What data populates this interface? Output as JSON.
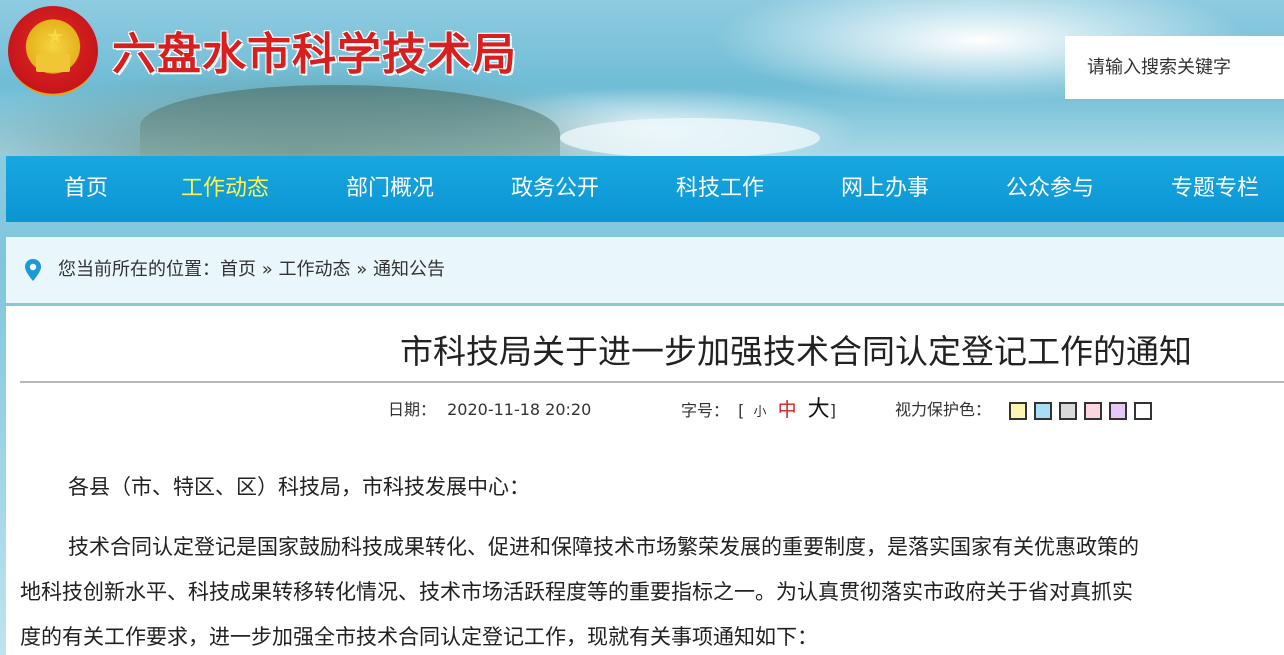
{
  "header": {
    "site_title": "六盘水市科学技术局",
    "search_placeholder": "请输入搜索关键字"
  },
  "nav": {
    "items": [
      {
        "label": "首页",
        "active": false
      },
      {
        "label": "工作动态",
        "active": true
      },
      {
        "label": "部门概况",
        "active": false
      },
      {
        "label": "政务公开",
        "active": false
      },
      {
        "label": "科技工作",
        "active": false
      },
      {
        "label": "网上办事",
        "active": false
      },
      {
        "label": "公众参与",
        "active": false
      },
      {
        "label": "专题专栏",
        "active": false
      }
    ],
    "active_color": "#fff44f"
  },
  "breadcrumb": {
    "prefix": "您当前所在的位置：",
    "items": [
      "首页",
      "工作动态",
      "通知公告"
    ],
    "separator": "»"
  },
  "article": {
    "title": "市科技局关于进一步加强技术合同认定登记工作的通知",
    "date_label": "日期：",
    "date_value": "2020-11-18 20:20",
    "fontsize_label": "字号：",
    "fontsize_open": "[",
    "fontsize_close": "]",
    "fontsize_small": "小",
    "fontsize_medium": "中",
    "fontsize_large": "大",
    "eye_protect_label": "视力保护色：",
    "eye_protect_colors": [
      "#fbf4b2",
      "#a8dff5",
      "#d9d9d9",
      "#fbd6e0",
      "#e6c8f6",
      "#ffffff"
    ],
    "paragraphs": [
      "各县（市、特区、区）科技局，市科技发展中心：",
      "技术合同认定登记是国家鼓励科技成果转化、促进和保障技术市场繁荣发展的重要制度，是落实国家有关优惠政策的",
      "地科技创新水平、科技成果转移转化情况、技术市场活跃程度等的重要指标之一。为认真贯彻落实市政府关于省对真抓实",
      "度的有关工作要求，进一步加强全市技术合同认定登记工作，现就有关事项通知如下："
    ]
  }
}
